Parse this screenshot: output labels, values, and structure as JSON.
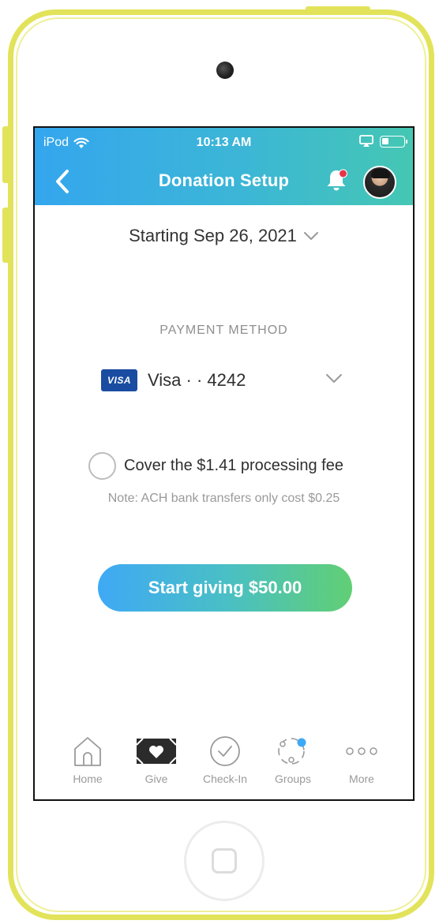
{
  "status_bar": {
    "carrier": "iPod",
    "time": "10:13 AM"
  },
  "header": {
    "title": "Donation Setup",
    "back_icon": "chevron-left-icon",
    "notification_icon": "bell-icon",
    "has_notification_dot": true
  },
  "schedule": {
    "start_label": "Starting Sep 26, 2021"
  },
  "payment": {
    "section_label": "PAYMENT METHOD",
    "card_brand": "VISA",
    "card_text": "Visa  ·  ·  4242"
  },
  "fee": {
    "option_label": "Cover the $1.41 processing fee",
    "checked": false,
    "note": "Note: ACH bank transfers only cost $0.25"
  },
  "cta": {
    "label": "Start giving $50.00"
  },
  "tab_bar": {
    "items": [
      {
        "label": "Home",
        "icon": "home-icon"
      },
      {
        "label": "Give",
        "icon": "give-icon"
      },
      {
        "label": "Check-In",
        "icon": "check-circle-icon"
      },
      {
        "label": "Groups",
        "icon": "groups-icon"
      },
      {
        "label": "More",
        "icon": "more-icon"
      }
    ]
  },
  "colors": {
    "device_frame": "#e2e35a",
    "header_gradient_start": "#34a6ee",
    "header_gradient_end": "#45c7b3",
    "cta_gradient_start": "#3fa9f5",
    "cta_gradient_end": "#61cf74",
    "visa_blue": "#1a4da1",
    "notification_red": "#e8344a",
    "groups_dot": "#3fa9f5"
  }
}
